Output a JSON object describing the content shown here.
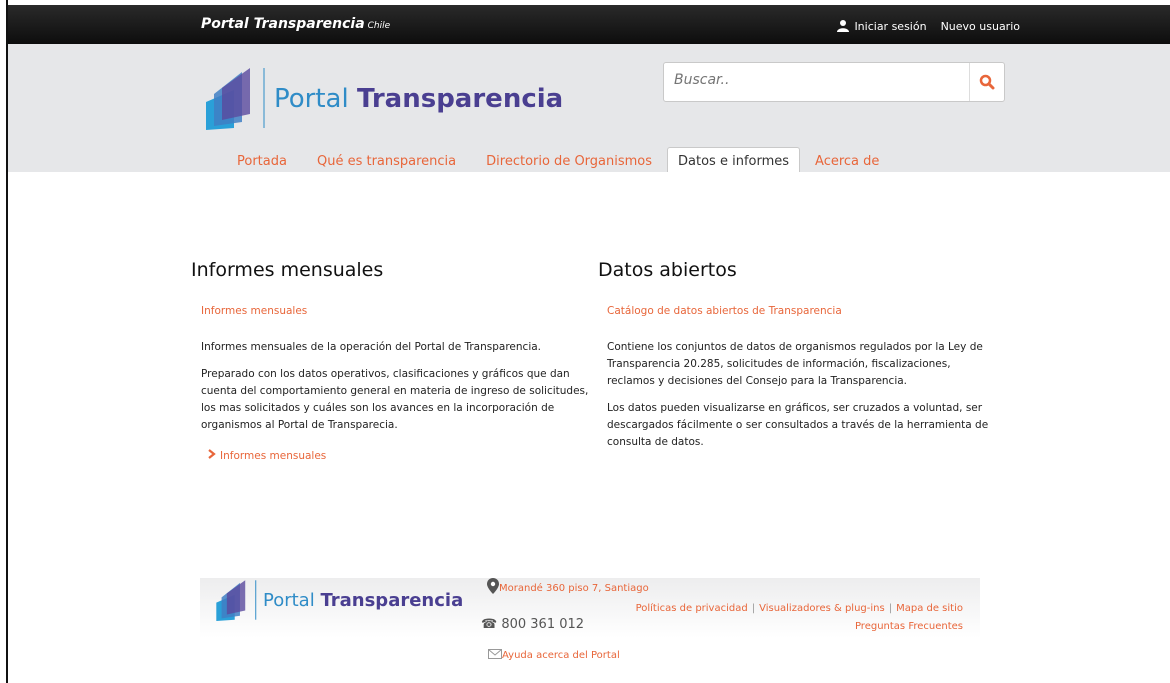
{
  "topbar": {
    "brand": "Portal Transparencia",
    "brand_suffix": "Chile",
    "login": "Iniciar sesión",
    "new_user": "Nuevo usuario"
  },
  "header": {
    "logo_light": "Portal",
    "logo_bold": "Transparencia",
    "search_placeholder": "Buscar.."
  },
  "nav": {
    "items": [
      "Portada",
      "Qué es transparencia",
      "Directorio de Organismos",
      "Datos e informes",
      "Acerca de"
    ]
  },
  "left": {
    "title": "Informes mensuales",
    "link": "Informes mensuales",
    "p1": "Informes mensuales de la operación del Portal de Transparencia.",
    "p2": "Preparado con los datos operativos, clasificaciones y gráficos que dan cuenta del comportamiento general en materia de ingreso de solicitudes, los mas solicitados y cuáles son los avances en la incorporación de organismos al Portal de Transparecia.",
    "bottom_link": "Informes mensuales"
  },
  "right": {
    "title": "Datos abiertos",
    "link": "Catálogo de datos abiertos de Transparencia",
    "p1": "Contiene los conjuntos de datos de organismos regulados por la Ley de Transparencia 20.285, solicitudes de información, fiscalizaciones, reclamos y decisiones del Consejo para la Transparencia.",
    "p2": "Los datos pueden visualizarse en gráficos, ser cruzados a voluntad, ser descargados fácilmente o ser consultados a través de la herramienta de consulta de datos."
  },
  "footer": {
    "logo_light": "Portal",
    "logo_bold": "Transparencia",
    "address": "Morandé 360 piso 7, Santiago",
    "phone": "800 361 012",
    "help": "Ayuda acerca del Portal",
    "links": [
      "Políticas de privacidad",
      "Visualizadores & plug-ins",
      "Mapa de sitio"
    ],
    "faq": "Preguntas Frecuentes"
  },
  "colors": {
    "accent": "#e8663a",
    "brand_blue": "#2f8cc7",
    "brand_purple": "#4a3f91"
  }
}
